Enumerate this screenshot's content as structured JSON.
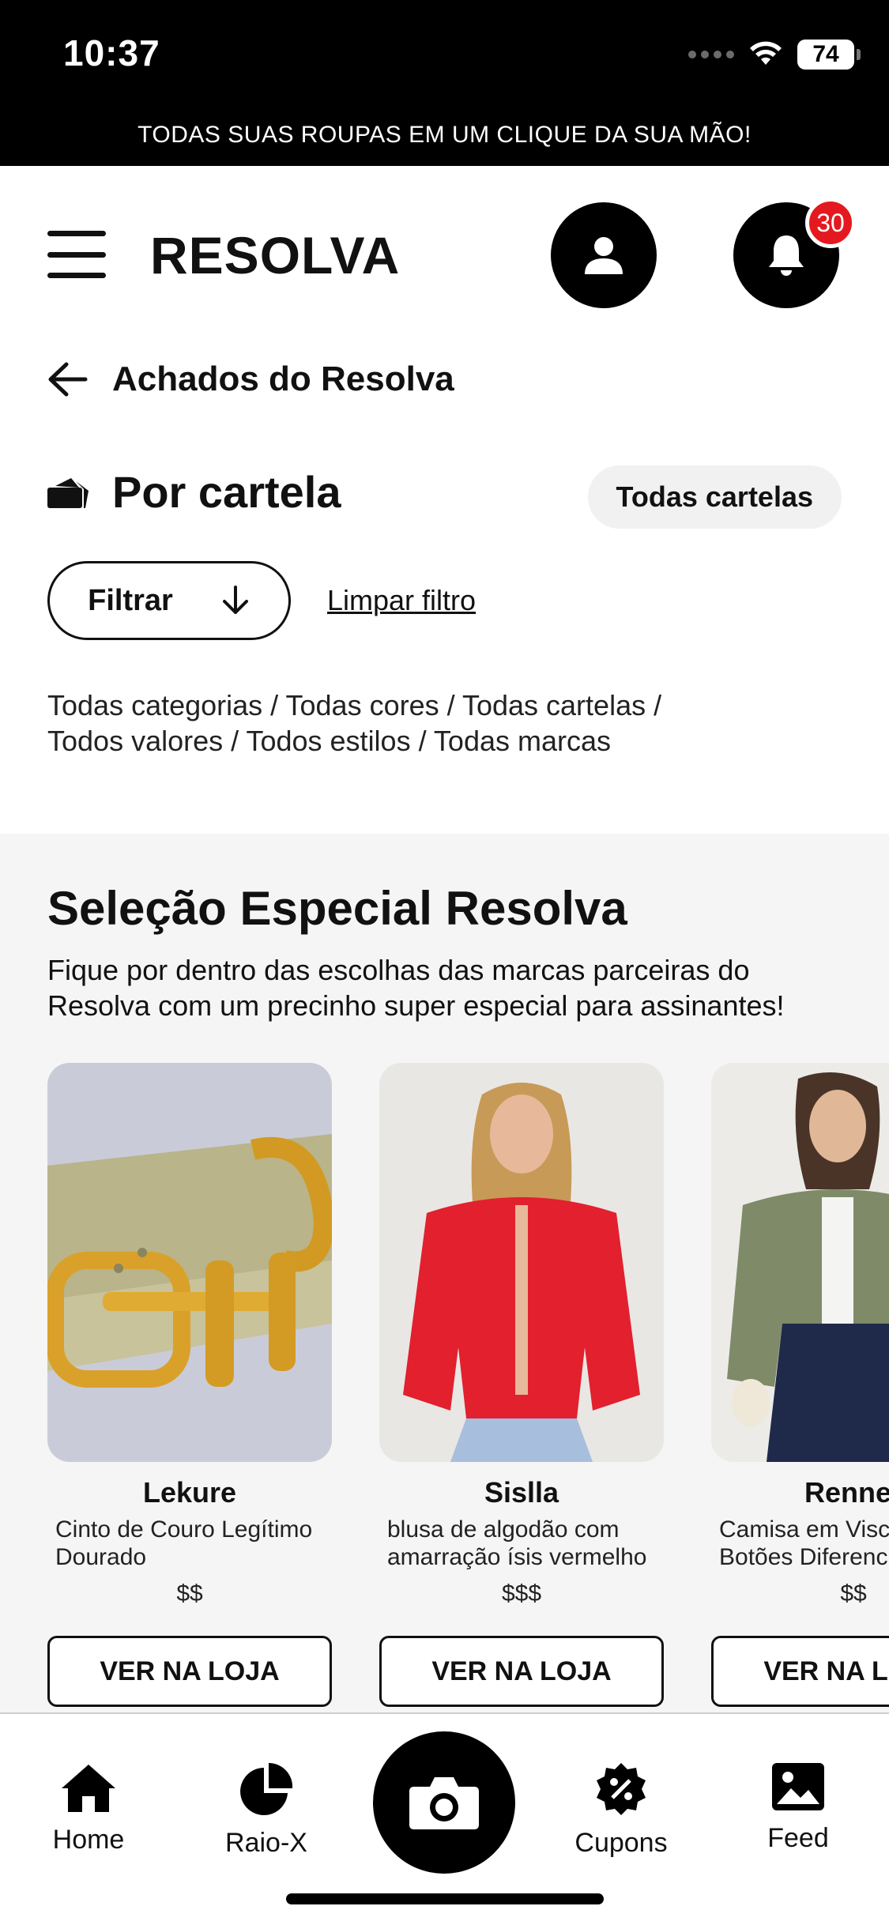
{
  "status_bar": {
    "time": "10:37",
    "battery": "74"
  },
  "promo_banner": "TODAS SUAS ROUPAS EM UM CLIQUE DA SUA MÃO!",
  "header": {
    "logo": "RESOLVA",
    "notification_count": "30"
  },
  "breadcrumb": {
    "title": "Achados do Resolva"
  },
  "section": {
    "title": "Por cartela",
    "all_button": "Todas cartelas"
  },
  "filters": {
    "filter_button": "Filtrar",
    "clear_link": "Limpar filtro",
    "summary_line1": "Todas categorias / Todas cores / Todas cartelas /",
    "summary_line2": "Todos valores / Todos estilos / Todas marcas"
  },
  "special_selection": {
    "title": "Seleção Especial Resolva",
    "description_line1": "Fique por dentro das escolhas das marcas parceiras do",
    "description_line2": "Resolva com um precinho super especial para assinantes!",
    "products": [
      {
        "brand": "Lekure",
        "desc_line1": "Cinto de Couro Legítimo",
        "desc_line2": "Dourado",
        "price": "$$",
        "button": "VER NA LOJA"
      },
      {
        "brand": "Sislla",
        "desc_line1": "blusa de algodão com",
        "desc_line2": "amarração ísis vermelho",
        "price": "$$$",
        "button": "VER NA LOJA"
      },
      {
        "brand": "Renner",
        "desc_line1": "Camisa em Viscose",
        "desc_line2": "Botões Diferenciados",
        "price": "$$",
        "button": "VER NA LOJA"
      }
    ]
  },
  "tabbar": {
    "home": "Home",
    "raiox": "Raio-X",
    "cupons": "Cupons",
    "feed": "Feed"
  },
  "icons": [
    "menu-icon",
    "user-icon",
    "bell-icon",
    "arrow-left-icon",
    "cards-icon",
    "arrow-down-icon",
    "home-icon",
    "pie-chart-icon",
    "camera-icon",
    "coupon-icon",
    "image-icon",
    "wifi-icon"
  ],
  "colors": {
    "primary": "#000000",
    "badge": "#e4191f",
    "chip_bg": "#f1f1f1",
    "section_bg": "#f5f5f5"
  }
}
